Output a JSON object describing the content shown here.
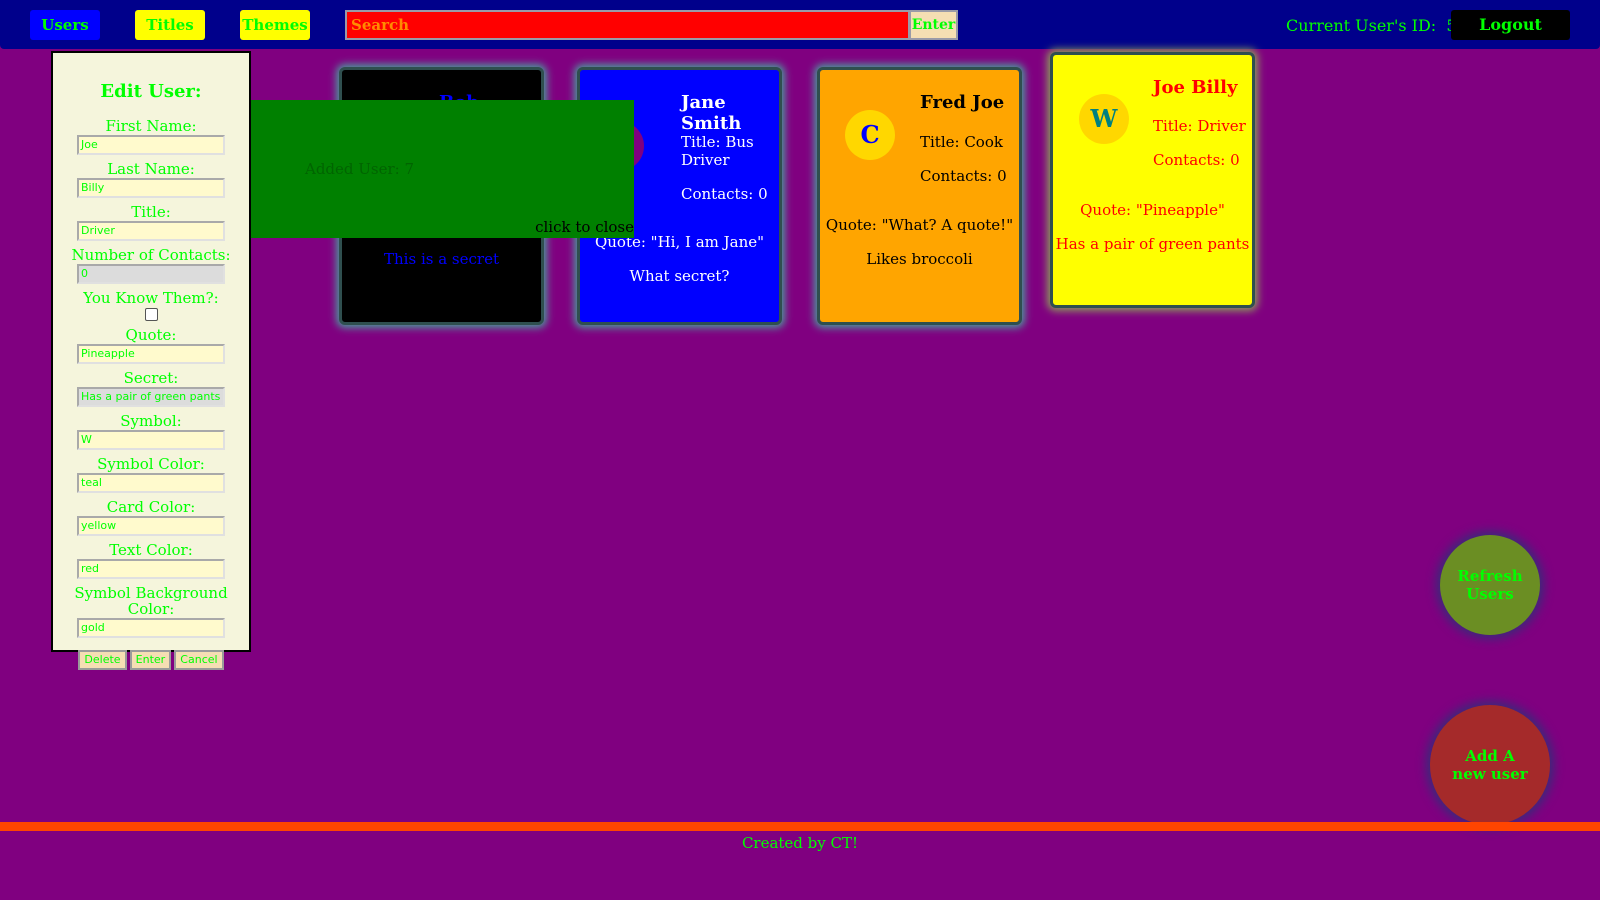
{
  "nav": {
    "users_label": "Users",
    "titles_label": "Titles",
    "themes_label": "Themes",
    "search_placeholder": "Search",
    "search_enter_label": "Enter",
    "current_user_label": "Current User's ID:  5",
    "logout_label": "Logout"
  },
  "edit_panel": {
    "title": "Edit User:",
    "first_name_label": "First Name:",
    "first_name_value": "Joe",
    "last_name_label": "Last Name:",
    "last_name_value": "Billy",
    "title_label": "Title:",
    "title_value": "Driver",
    "contacts_label": "Number of Contacts:",
    "contacts_value": "0",
    "know_label": "You Know Them?:",
    "know_checked": false,
    "quote_label": "Quote:",
    "quote_value": "Pineapple",
    "secret_label": "Secret:",
    "secret_value": "Has a pair of green pants",
    "symbol_label": "Symbol:",
    "symbol_value": "W",
    "symbol_color_label": "Symbol Color:",
    "symbol_color_value": "teal",
    "card_color_label": "Card Color:",
    "card_color_value": "yellow",
    "text_color_label": "Text Color:",
    "text_color_value": "red",
    "symbol_bg_label": "Symbol Background Color:",
    "symbol_bg_value": "gold",
    "delete_label": "Delete",
    "enter_label": "Enter",
    "cancel_label": "Cancel"
  },
  "cards": [
    {
      "name": "Bob Smith",
      "secret": "This is a secret",
      "card_color": "#000000",
      "text_color": "#0000ff"
    },
    {
      "name": "Jane Smith",
      "title": "Title: Bus Driver",
      "contacts": "Contacts: 0",
      "quote": "Quote: \"Hi, I am Jane\"",
      "secret": "What secret?",
      "card_color": "#0000ff",
      "text_color": "#ffffff",
      "symbol_bg": "#800080"
    },
    {
      "name": "Fred Joe",
      "symbol": "C",
      "title": "Title: Cook",
      "contacts": "Contacts: 0",
      "quote": "Quote: \"What? A quote!\"",
      "secret": "Likes broccoli",
      "card_color": "#ffa500",
      "text_color": "#000000",
      "symbol_color": "#0000ff",
      "symbol_bg": "#ffd700"
    },
    {
      "name": "Joe Billy",
      "symbol": "W",
      "title": "Title: Driver",
      "contacts": "Contacts: 0",
      "quote": "Quote: \"Pineapple\"",
      "secret": "Has a pair of green pants",
      "card_color": "#ffff00",
      "text_color": "#ff0000",
      "symbol_color": "#008080",
      "symbol_bg": "#ffd700"
    }
  ],
  "popup": {
    "message": "Added User: 7",
    "close_label": "click to close"
  },
  "fab": {
    "refresh_label": "Refresh Users",
    "add_label": "Add A new user"
  },
  "footer": {
    "text": "Created by CT!"
  }
}
